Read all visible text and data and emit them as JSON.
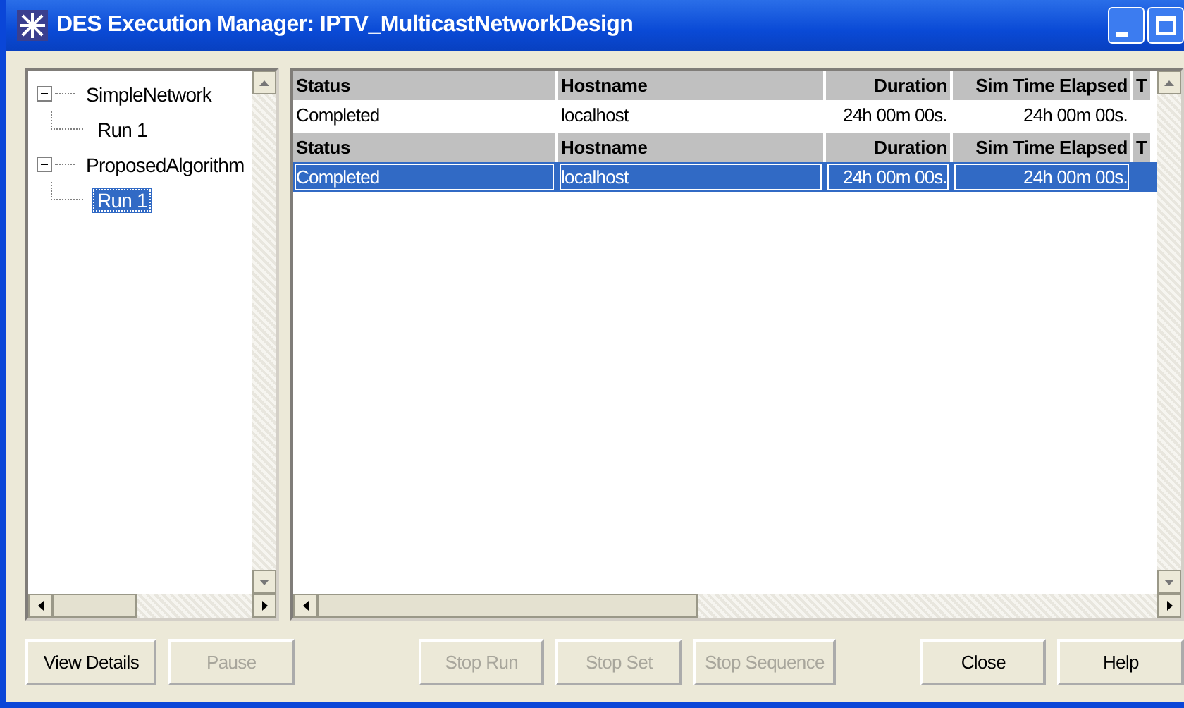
{
  "window": {
    "title": "DES Execution Manager: IPTV_MulticastNetworkDesign"
  },
  "tree": [
    {
      "label": "SimpleNetwork",
      "expanded": true,
      "selected": false,
      "children": [
        {
          "label": "Run 1",
          "selected": false
        }
      ]
    },
    {
      "label": "ProposedAlgorithm",
      "expanded": true,
      "selected": false,
      "children": [
        {
          "label": "Run 1",
          "selected": true
        }
      ]
    }
  ],
  "runs": [
    {
      "columns": [
        "Status",
        "Hostname",
        "Duration",
        "Sim Time Elapsed",
        "T"
      ],
      "row": {
        "cells": [
          "Completed",
          "localhost",
          "24h 00m 00s.",
          "24h 00m 00s."
        ],
        "selected": false
      }
    },
    {
      "columns": [
        "Status",
        "Hostname",
        "Duration",
        "Sim Time Elapsed",
        "T"
      ],
      "row": {
        "cells": [
          "Completed",
          "localhost",
          "24h 00m 00s.",
          "24h 00m 00s."
        ],
        "selected": true
      }
    }
  ],
  "buttons": [
    {
      "label": "View Details",
      "disabled": false
    },
    {
      "label": "Pause",
      "disabled": true
    },
    {
      "label": "Stop Run",
      "disabled": true
    },
    {
      "label": "Stop Set",
      "disabled": true
    },
    {
      "label": "Stop Sequence",
      "disabled": true
    },
    {
      "label": "Close",
      "disabled": false
    },
    {
      "label": "Help",
      "disabled": false
    }
  ]
}
